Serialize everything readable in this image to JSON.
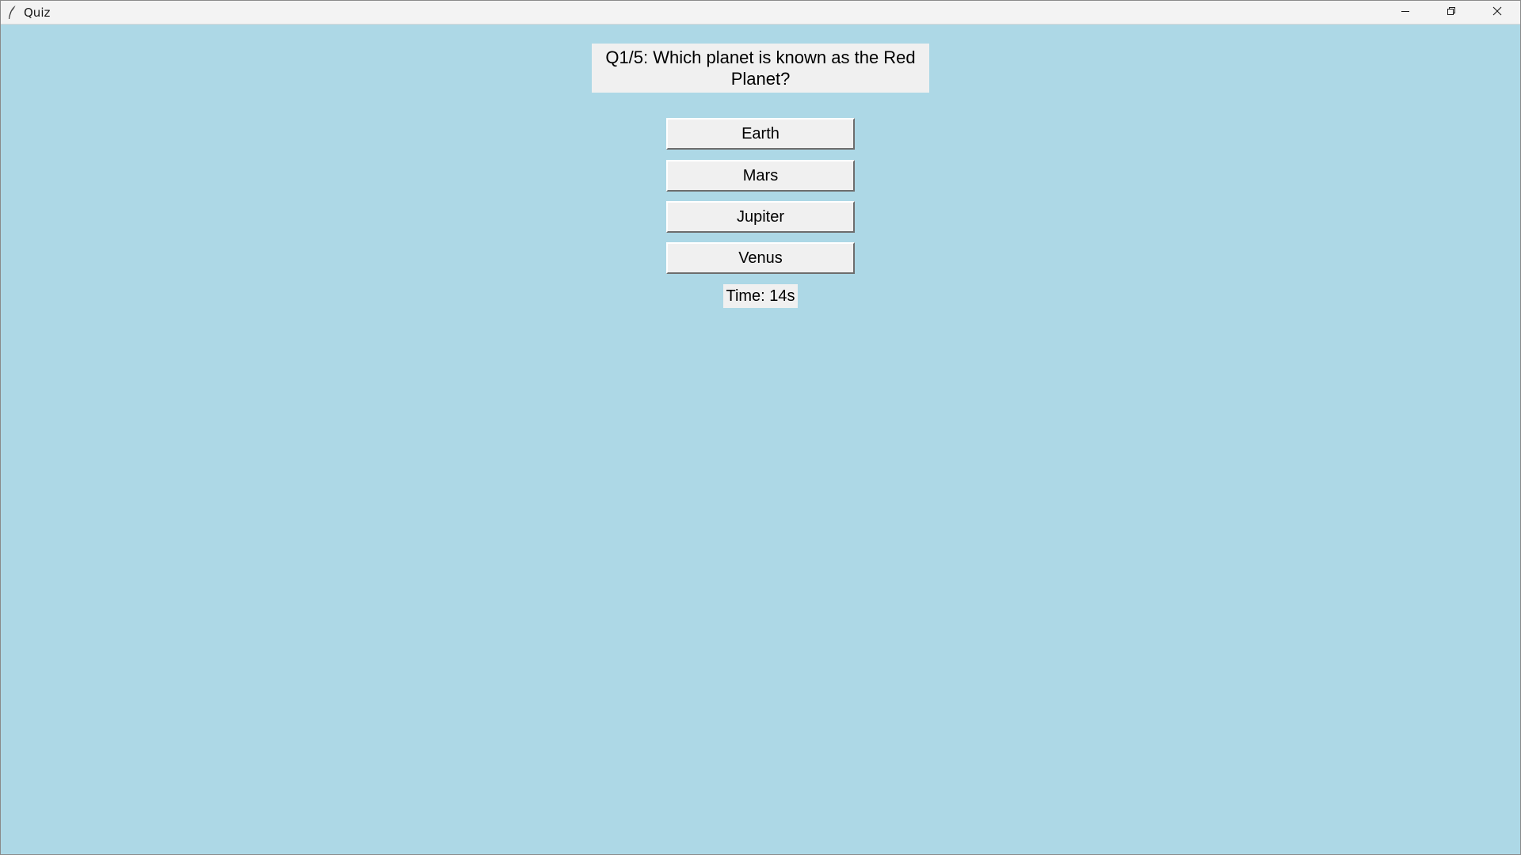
{
  "window": {
    "title": "Quiz",
    "background_color": "#add8e6",
    "icon": "feather-icon"
  },
  "window_controls": {
    "minimize_icon": "minimize-icon",
    "maximize_icon": "restore-icon",
    "close_icon": "close-icon"
  },
  "quiz": {
    "question": "Q1/5: Which planet is known as the Red Planet?",
    "question_number": 1,
    "total_questions": 5,
    "answers": [
      {
        "label": "Earth"
      },
      {
        "label": "Mars"
      },
      {
        "label": "Jupiter"
      },
      {
        "label": "Venus"
      }
    ],
    "timer_text": "Time: 14s"
  }
}
